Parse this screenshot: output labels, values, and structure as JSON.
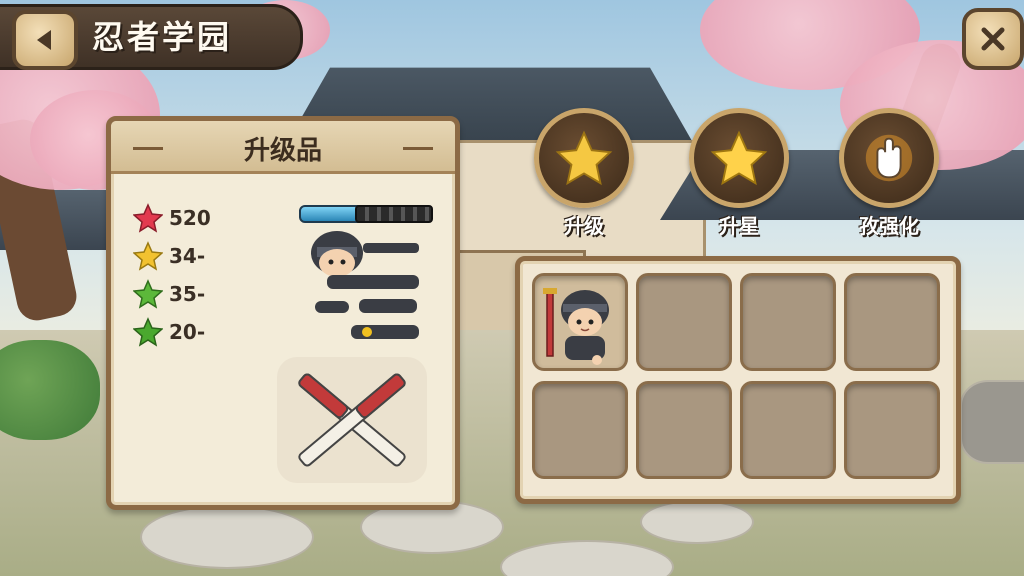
{
  "header": {
    "title": "忍者学园",
    "back_icon": "back-arrow-icon",
    "close_icon": "close-icon"
  },
  "upgrade_panel": {
    "title": "升级品",
    "stats": [
      {
        "star": "red-star-icon",
        "color": "#e23a4f",
        "value": "520"
      },
      {
        "star": "yellow-star-icon",
        "color": "#f2c230",
        "value": "34-"
      },
      {
        "star": "green-star-icon",
        "color": "#5cb83a",
        "value": "35-"
      },
      {
        "star": "green-star-icon",
        "color": "#4aa82e",
        "value": "20-"
      }
    ]
  },
  "skills": [
    {
      "label": "升级",
      "icon": "star-icon"
    },
    {
      "label": "升星",
      "icon": "star-icon"
    },
    {
      "label": "孜强化",
      "icon": "hand-icon"
    }
  ],
  "inventory": {
    "slots": [
      {
        "item": "ninja-character"
      },
      {
        "item": ""
      },
      {
        "item": ""
      },
      {
        "item": ""
      },
      {
        "item": ""
      },
      {
        "item": ""
      },
      {
        "item": ""
      },
      {
        "item": ""
      }
    ]
  },
  "colors": {
    "panel_border": "#8c6a45",
    "panel_bg": "#f3ecd9",
    "accent_gold": "#c9a56a"
  }
}
